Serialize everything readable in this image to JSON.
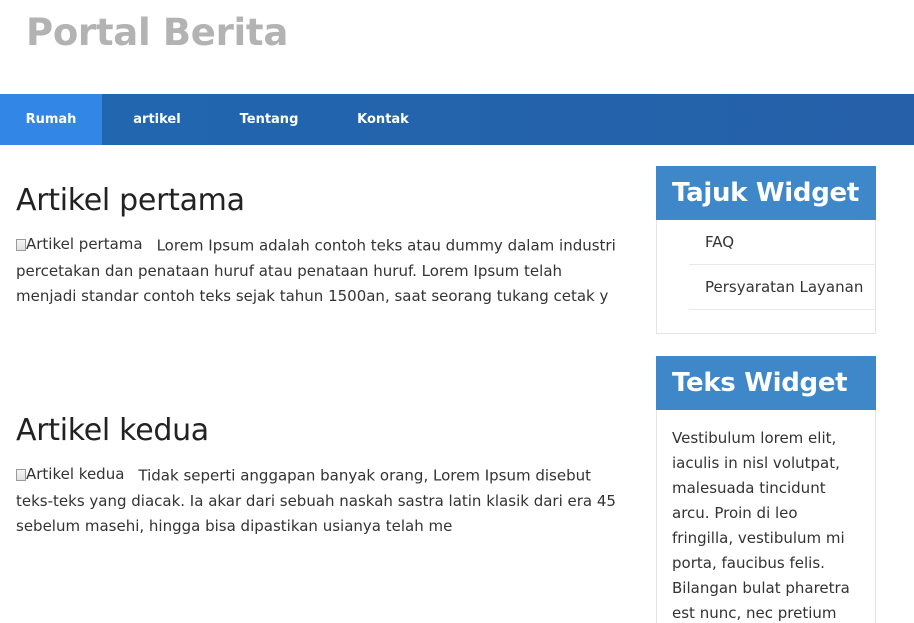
{
  "site": {
    "title": "Portal Berita"
  },
  "nav": {
    "items": [
      {
        "label": "Rumah"
      },
      {
        "label": "artikel"
      },
      {
        "label": "Tentang"
      },
      {
        "label": "Kontak"
      }
    ]
  },
  "articles": [
    {
      "title": "Artikel pertama",
      "image_alt": "Artikel pertama",
      "body": "Lorem Ipsum adalah contoh teks atau dummy dalam industri percetakan dan penataan huruf atau penataan huruf. Lorem Ipsum telah menjadi standar contoh teks sejak tahun 1500an, saat seorang tukang cetak y"
    },
    {
      "title": "Artikel kedua",
      "image_alt": "Artikel kedua",
      "body": "Tidak seperti anggapan banyak orang, Lorem Ipsum disebut teks-teks yang diacak. Ia akar dari sebuah naskah sastra latin klasik dari era 45 sebelum masehi, hingga bisa dipastikan usianya telah me"
    }
  ],
  "sidebar": {
    "widget1": {
      "title": "Tajuk Widget",
      "links": [
        {
          "label": "FAQ"
        },
        {
          "label": "Persyaratan Layanan"
        }
      ]
    },
    "widget2": {
      "title": "Teks Widget",
      "text": "Vestibulum lorem elit, iaculis in nisl volutpat, malesuada tincidunt arcu. Proin di leo fringilla, vestibulum mi porta, faucibus felis. Bilangan bulat pharetra est nunc, nec pretium nunc pretium"
    }
  },
  "colors": {
    "navbar": "#2364ad",
    "nav_active": "#3186e6",
    "widget_header": "#3e87c9",
    "site_title": "#b3b3b3"
  }
}
